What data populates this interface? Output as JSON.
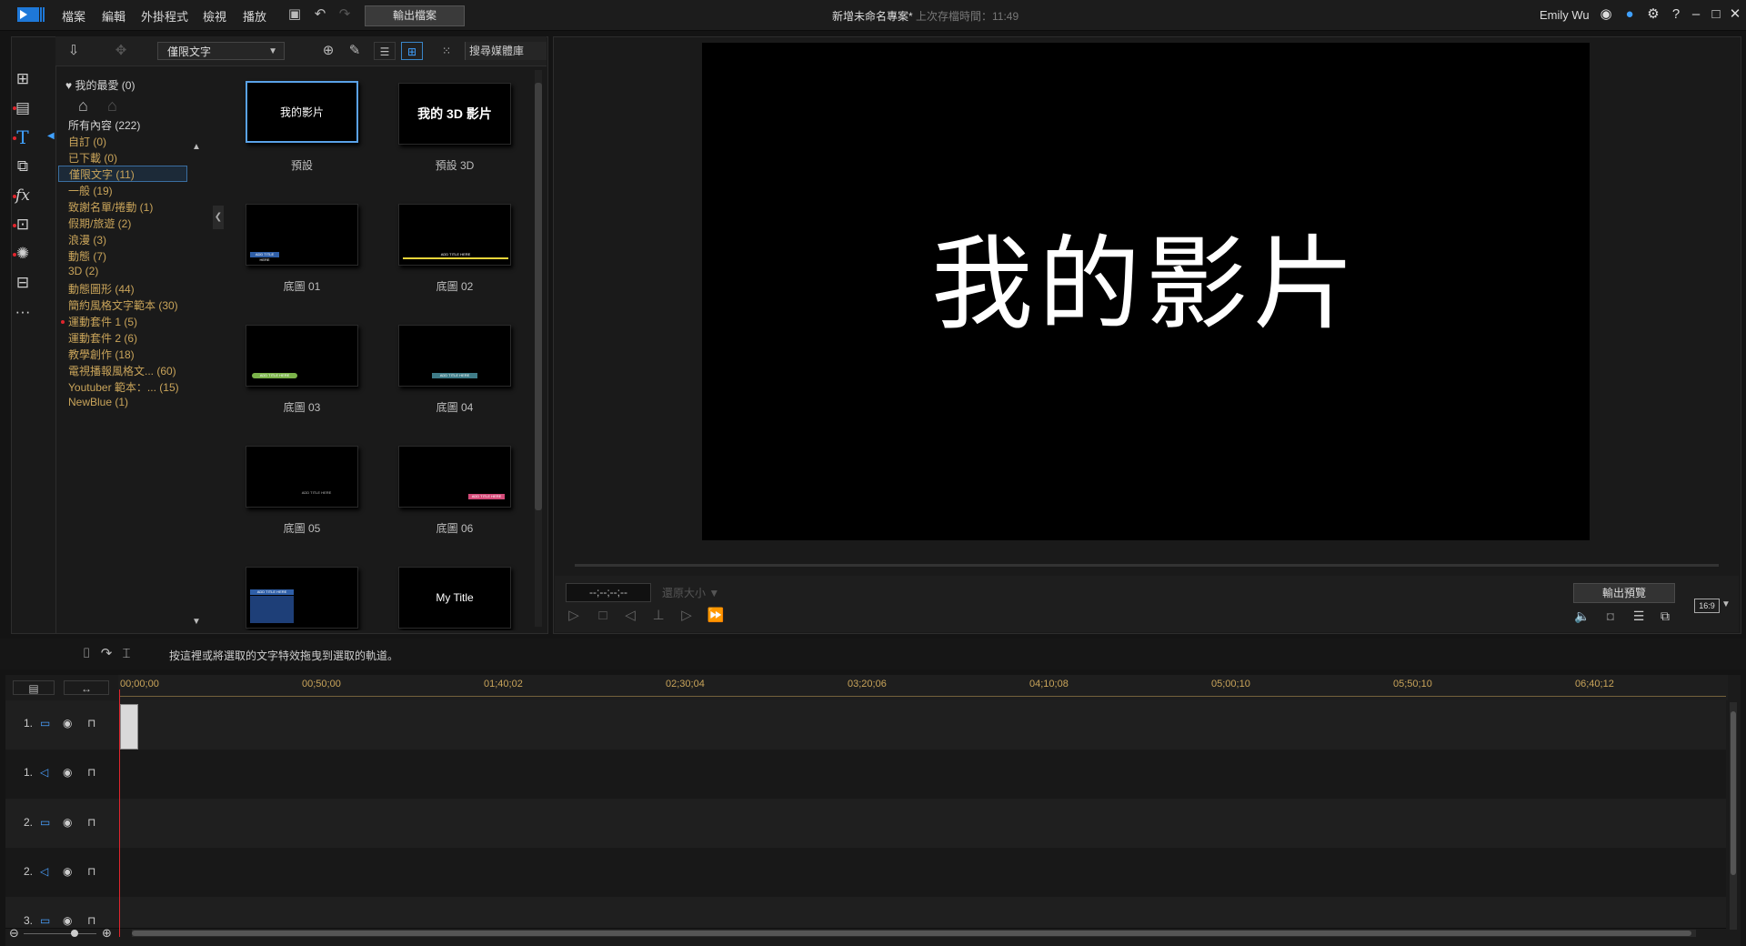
{
  "menu": [
    "檔案",
    "編輯",
    "外掛程式",
    "檢視",
    "播放"
  ],
  "toolbar": {
    "export_label": "輸出檔案"
  },
  "project": {
    "name": "新增未命名專案*",
    "last_saved": "上次存檔時間：11:49"
  },
  "user": {
    "name": "Emily Wu"
  },
  "library": {
    "filter_value": "僅限文字",
    "search_placeholder": "搜尋媒體庫",
    "favorites": "我的最愛 (0)",
    "categories": [
      "所有內容 (222)",
      "自訂  (0)",
      "已下載  (0)",
      "僅限文字  (11)",
      "一般  (19)",
      "致謝名單/捲動  (1)",
      "假期/旅遊  (2)",
      "浪漫  (3)",
      "動態  (7)",
      "3D  (2)",
      "動態圖形  (44)",
      "簡約風格文字範本  (30)",
      "運動套件 1  (5)",
      "運動套件 2  (6)",
      "教學創作  (18)",
      "電視播報風格文...  (60)",
      "Youtuber 範本：...  (15)",
      "NewBlue  (1)"
    ],
    "templates": [
      {
        "label": "預設",
        "preview": "我的影片"
      },
      {
        "label": "預設 3D",
        "preview": "我的 3D 影片"
      },
      {
        "label": "底圖 01",
        "preview": "ADD TITLE HERE"
      },
      {
        "label": "底圖 02",
        "preview": "ADD TITLE HERE"
      },
      {
        "label": "底圖 03",
        "preview": "ADD TITLE HERE"
      },
      {
        "label": "底圖 04",
        "preview": "ADD TITLE HERE"
      },
      {
        "label": "底圖 05",
        "preview": "ADD TITLE HERE"
      },
      {
        "label": "底圖 06",
        "preview": "ADD TITLE HERE"
      },
      {
        "label": "",
        "preview": "ADD TITLE HERE"
      },
      {
        "label": "",
        "preview": "My Title"
      }
    ]
  },
  "preview": {
    "title_text": "我的影片",
    "timecode": "--;--;--;--",
    "size_label": "還原大小",
    "export_preview_label": "輸出預覽",
    "aspect": "16:9"
  },
  "hint": "按這裡或將選取的文字特效拖曳到選取的軌道。",
  "timeline": {
    "ticks": [
      "00;00;00",
      "00;50;00",
      "01;40;02",
      "02;30;04",
      "03;20;06",
      "04;10;08",
      "05;00;10",
      "05;50;10",
      "06;40;12"
    ],
    "tracks": [
      {
        "num": "1.",
        "type": "video"
      },
      {
        "num": "1.",
        "type": "audio"
      },
      {
        "num": "2.",
        "type": "video"
      },
      {
        "num": "2.",
        "type": "audio"
      },
      {
        "num": "3.",
        "type": "video"
      }
    ]
  },
  "colors": {
    "accent": "#3fa0ff",
    "category_text": "#c9a45a",
    "red_marker": "#e0252d"
  }
}
